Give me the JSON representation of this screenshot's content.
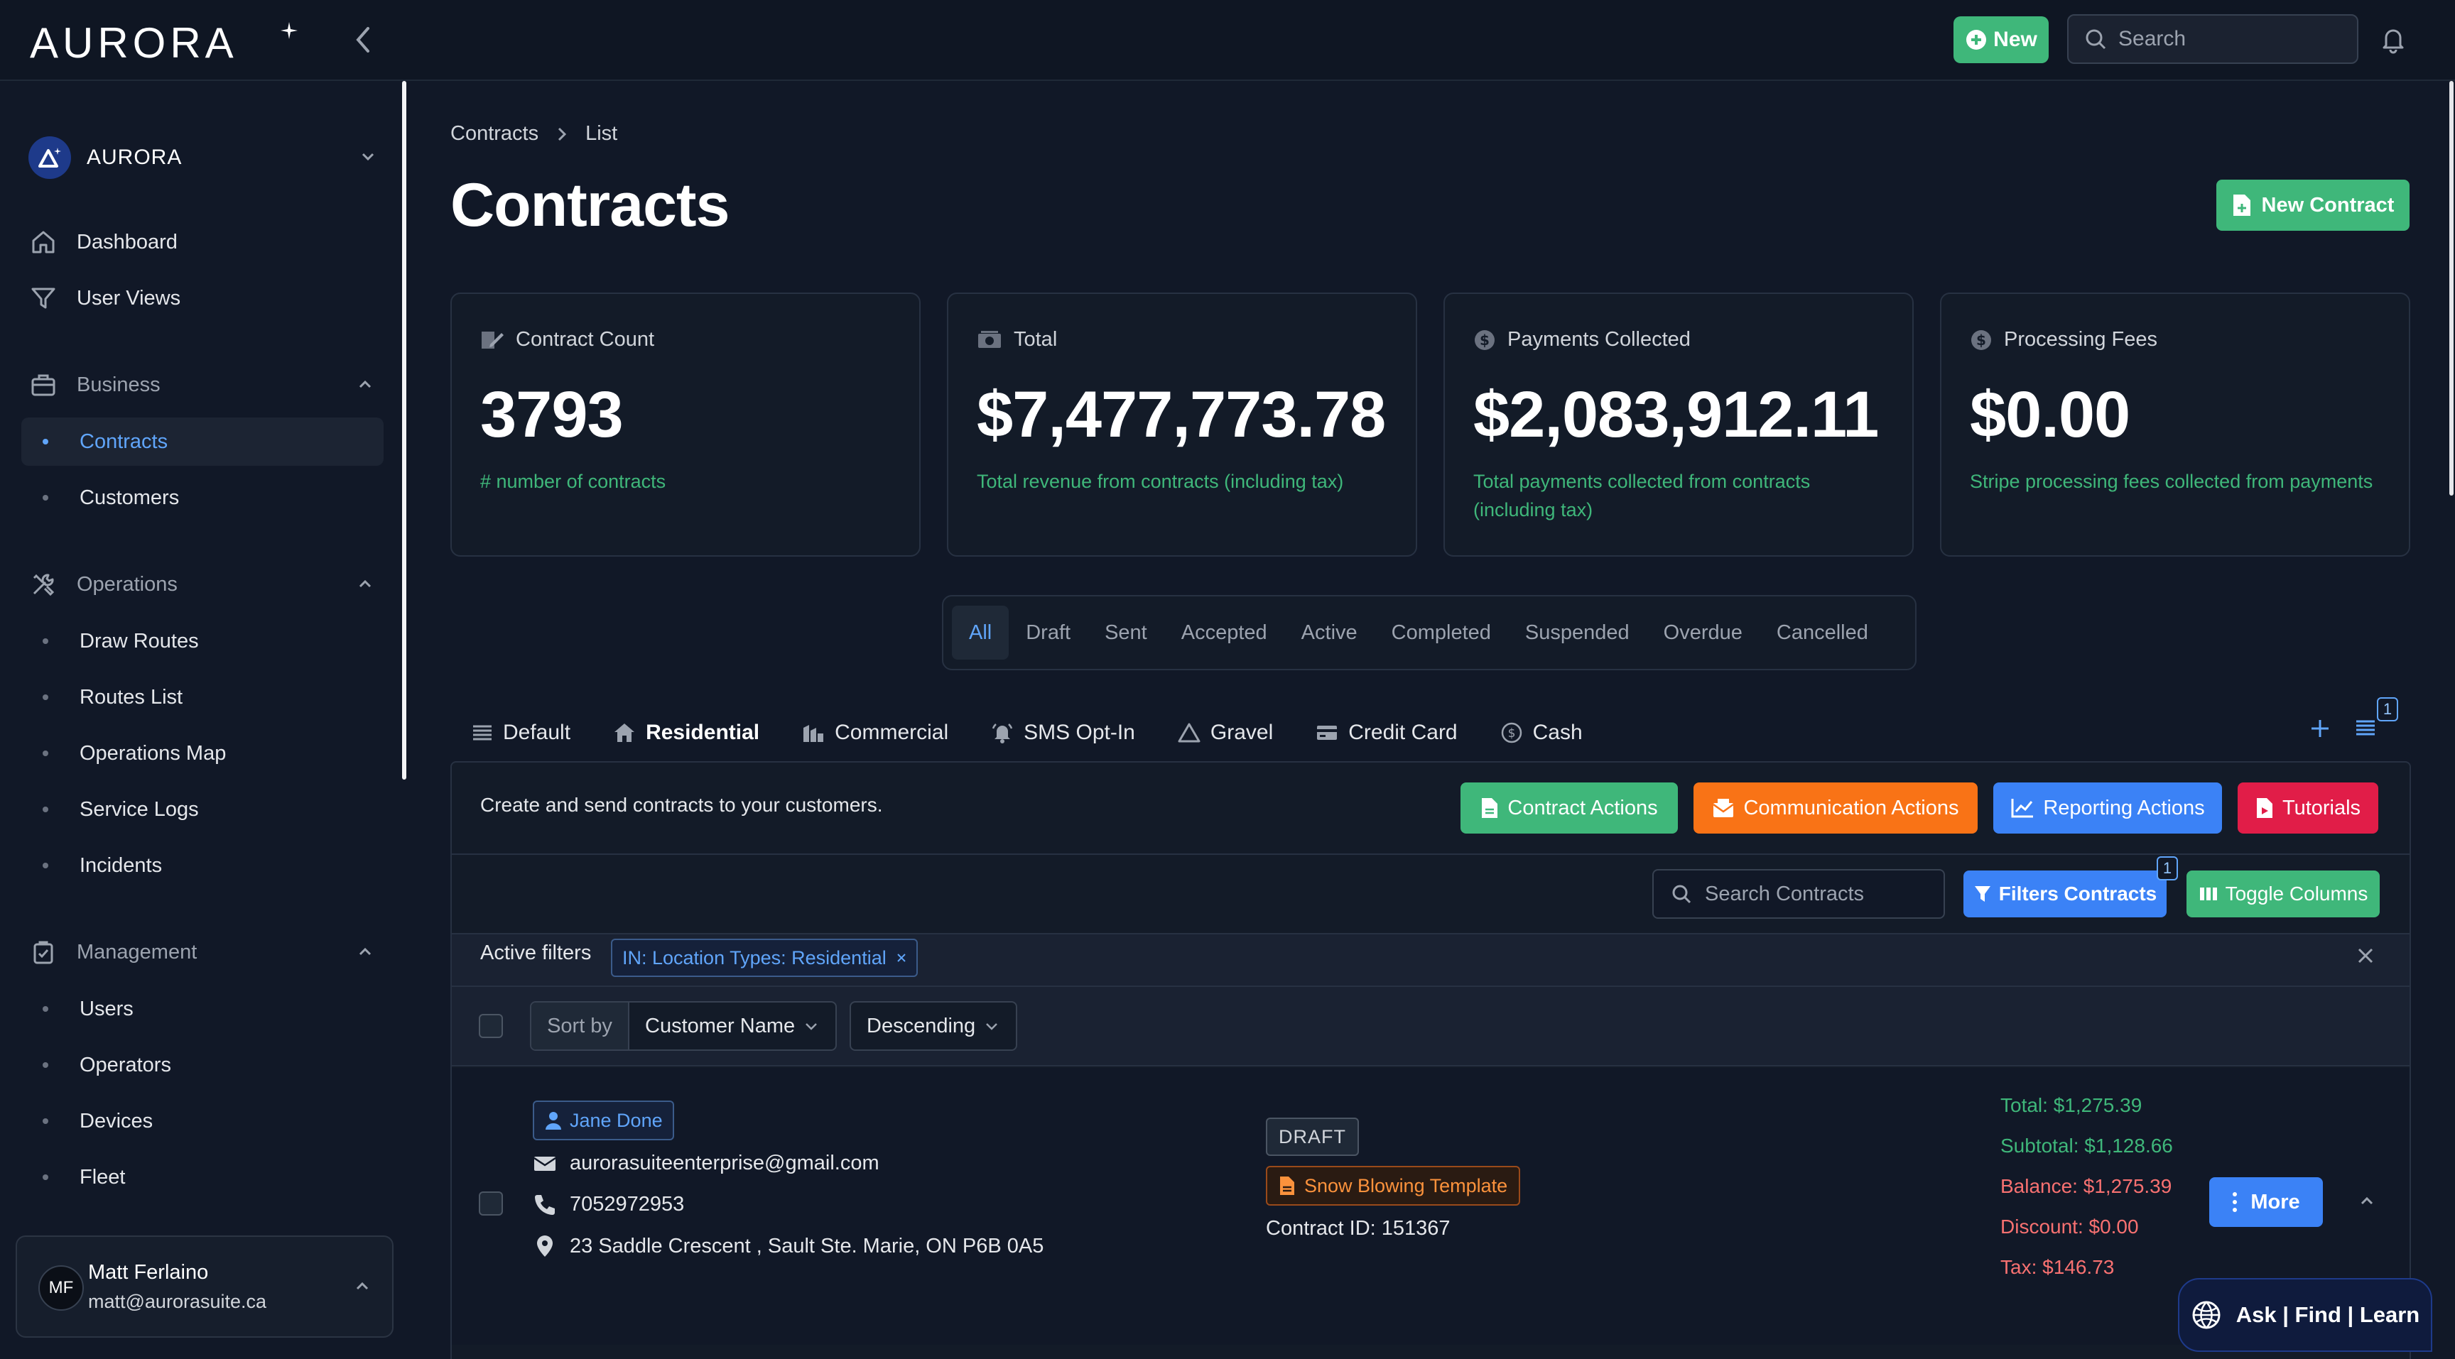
{
  "app": {
    "logo_text": "AURORA",
    "new_label": "New",
    "search_placeholder": "Search"
  },
  "sidebar": {
    "org_name": "AURORA",
    "top_items": [
      {
        "label": "Dashboard",
        "icon": "home-icon"
      },
      {
        "label": "User Views",
        "icon": "filter-icon"
      }
    ],
    "sections": [
      {
        "label": "Business",
        "icon": "briefcase-icon",
        "expanded": true,
        "items": [
          {
            "label": "Contracts",
            "active": true
          },
          {
            "label": "Customers"
          }
        ]
      },
      {
        "label": "Operations",
        "icon": "tools-icon",
        "expanded": true,
        "items": [
          {
            "label": "Draw Routes"
          },
          {
            "label": "Routes List"
          },
          {
            "label": "Operations Map"
          },
          {
            "label": "Service Logs"
          },
          {
            "label": "Incidents"
          }
        ]
      },
      {
        "label": "Management",
        "icon": "clipboard-check-icon",
        "expanded": true,
        "items": [
          {
            "label": "Users"
          },
          {
            "label": "Operators"
          },
          {
            "label": "Devices"
          },
          {
            "label": "Fleet"
          }
        ]
      }
    ],
    "user": {
      "initials": "MF",
      "name": "Matt Ferlaino",
      "email": "matt@aurorasuite.ca"
    }
  },
  "breadcrumb": [
    "Contracts",
    "List"
  ],
  "page_title": "Contracts",
  "new_contract_label": "New Contract",
  "stats": [
    {
      "label": "Contract Count",
      "icon": "contract-edit-icon",
      "value": "3793",
      "description": "# number of contracts"
    },
    {
      "label": "Total",
      "icon": "money-icon",
      "value": "$7,477,773.78",
      "description": "Total revenue from contracts (including tax)"
    },
    {
      "label": "Payments Collected",
      "icon": "dollar-circle-icon",
      "value": "$2,083,912.11",
      "description": "Total payments collected from contracts (including tax)"
    },
    {
      "label": "Processing Fees",
      "icon": "dollar-circle-icon",
      "value": "$0.00",
      "description": "Stripe processing fees collected from payments"
    }
  ],
  "status_tabs": [
    {
      "label": "All",
      "active": true
    },
    {
      "label": "Draft"
    },
    {
      "label": "Sent"
    },
    {
      "label": "Accepted"
    },
    {
      "label": "Active"
    },
    {
      "label": "Completed"
    },
    {
      "label": "Suspended"
    },
    {
      "label": "Overdue"
    },
    {
      "label": "Cancelled"
    }
  ],
  "view_tabs": [
    {
      "label": "Default",
      "icon": "list-icon"
    },
    {
      "label": "Residential",
      "icon": "house-icon",
      "active": true
    },
    {
      "label": "Commercial",
      "icon": "building-icon"
    },
    {
      "label": "SMS Opt-In",
      "icon": "bell-ring-icon"
    },
    {
      "label": "Gravel",
      "icon": "triangle-warning-icon"
    },
    {
      "label": "Credit Card",
      "icon": "credit-card-icon"
    },
    {
      "label": "Cash",
      "icon": "coin-icon"
    }
  ],
  "views_badge": "1",
  "panel": {
    "description": "Create and send contracts to your customers.",
    "actions": [
      {
        "label": "Contract Actions",
        "color": "#3fb77a",
        "icon": "document-icon"
      },
      {
        "label": "Communication Actions",
        "color": "#f97316",
        "icon": "envelope-icon"
      },
      {
        "label": "Reporting Actions",
        "color": "#3b82f6",
        "icon": "chart-line-icon"
      },
      {
        "label": "Tutorials",
        "color": "#e11d48",
        "icon": "video-file-icon"
      }
    ],
    "search_placeholder": "Search Contracts",
    "filters_label": "Filters Contracts",
    "filters_badge": "1",
    "toggle_columns_label": "Toggle Columns",
    "active_filters_label": "Active filters",
    "active_filter_chip": "IN: Location Types: Residential",
    "sort_by_label": "Sort by",
    "sort_field": "Customer Name",
    "sort_order": "Descending"
  },
  "contract_row": {
    "customer_name": "Jane Done",
    "email": "aurorasuiteenterprise@gmail.com",
    "phone": "7052972953",
    "address": "23 Saddle Crescent , Sault Ste. Marie, ON P6B 0A5",
    "status": "DRAFT",
    "template": "Snow Blowing Template",
    "contract_id": "Contract ID: 151367",
    "total": "Total: $1,275.39",
    "subtotal": "Subtotal: $1,128.66",
    "balance": "Balance: $1,275.39",
    "discount": "Discount: $0.00",
    "tax": "Tax: $146.73",
    "more_label": "More"
  },
  "ask_label": "Ask | Find | Learn"
}
